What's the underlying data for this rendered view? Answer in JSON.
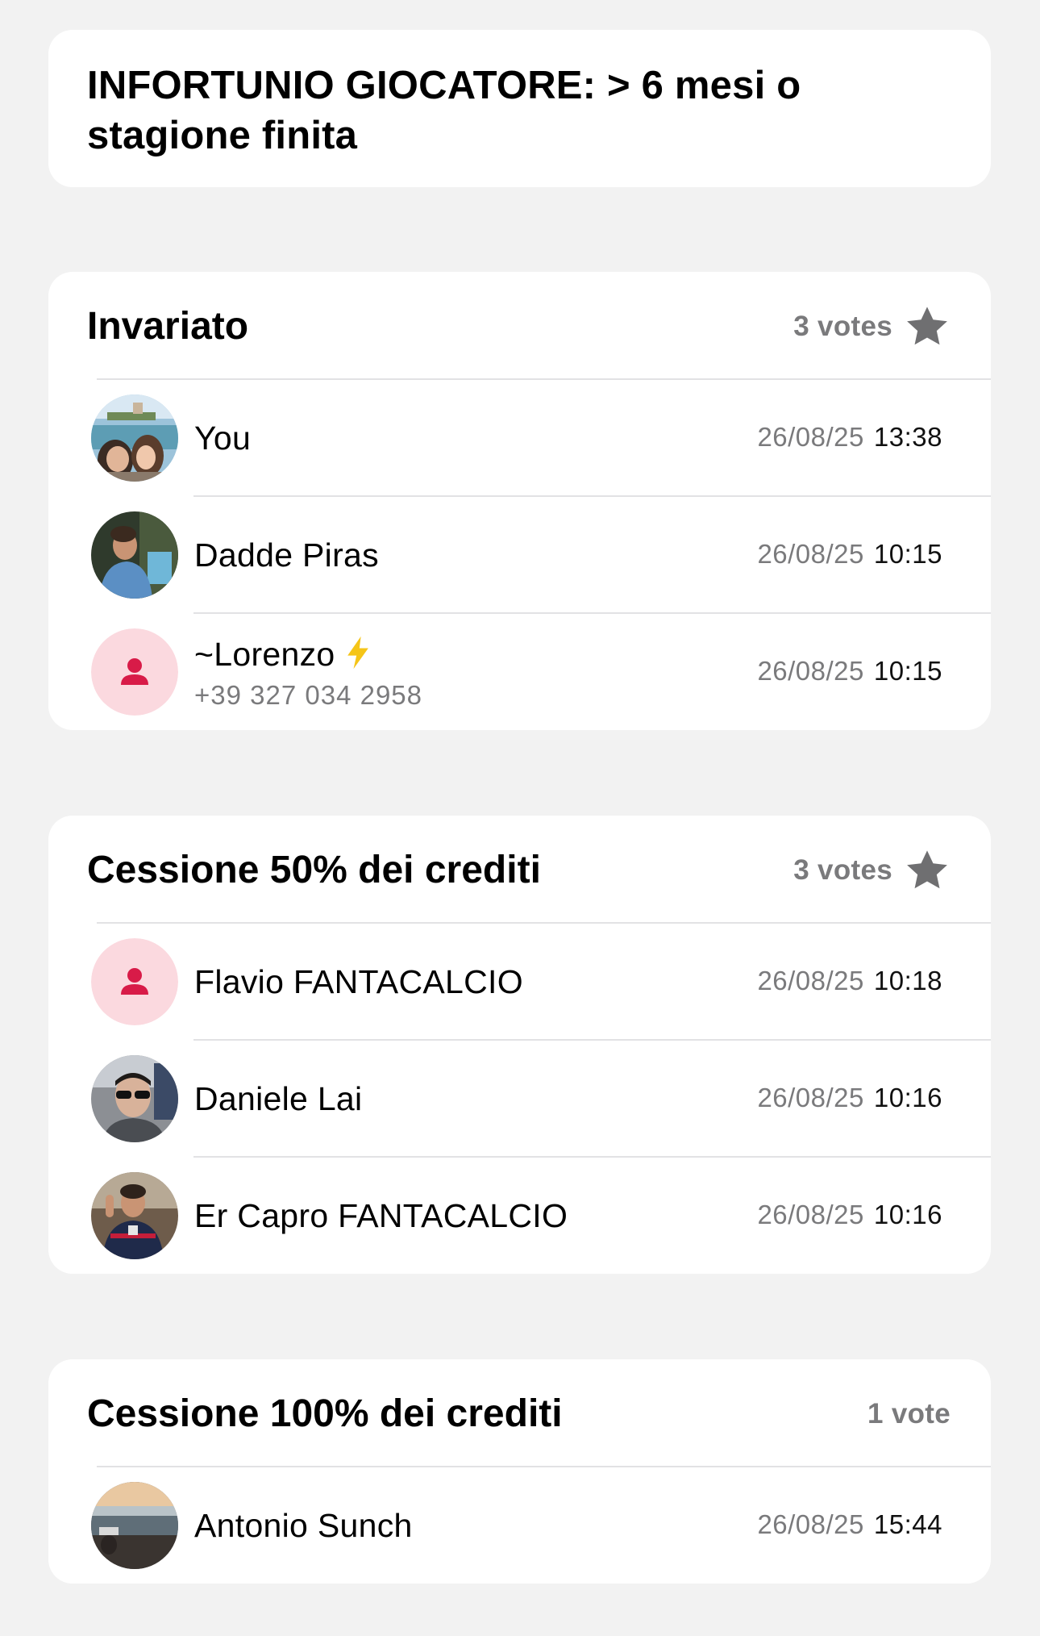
{
  "question": "INFORTUNIO GIOCATORE: > 6 mesi o stagione finita",
  "colors": {
    "background": "#f2f2f2",
    "card": "#ffffff",
    "secondary_text": "#7a7a7c",
    "star": "#6f6f71",
    "placeholder_avatar_bg": "#fbd9df",
    "placeholder_avatar_icon": "#d81b48",
    "bolt": "#f5c518"
  },
  "options": [
    {
      "title": "Invariato",
      "votes": "3 votes",
      "starred": true,
      "voters": [
        {
          "name": "You",
          "date": "26/08/25",
          "time": "13:38",
          "avatar": "photo-couple-sea"
        },
        {
          "name": "Dadde Piras",
          "date": "26/08/25",
          "time": "10:15",
          "avatar": "photo-man-rocks"
        },
        {
          "name": "~Lorenzo",
          "phone": "+39 327 034 2958",
          "date": "26/08/25",
          "time": "10:15",
          "avatar": "person-placeholder",
          "emoji": "lightning-bolt-icon"
        }
      ]
    },
    {
      "title": "Cessione 50% dei crediti",
      "votes": "3 votes",
      "starred": true,
      "voters": [
        {
          "name": "Flavio FANTACALCIO",
          "date": "26/08/25",
          "time": "10:18",
          "avatar": "person-placeholder"
        },
        {
          "name": "Daniele Lai",
          "date": "26/08/25",
          "time": "10:16",
          "avatar": "photo-man-sunglasses"
        },
        {
          "name": "Er Capro FANTACALCIO",
          "date": "26/08/25",
          "time": "10:16",
          "avatar": "photo-man-jersey"
        }
      ]
    },
    {
      "title": "Cessione 100% dei crediti",
      "votes": "1 vote",
      "starred": false,
      "voters": [
        {
          "name": "Antonio Sunch",
          "date": "26/08/25",
          "time": "15:44",
          "avatar": "photo-beach-sunset"
        }
      ]
    }
  ]
}
